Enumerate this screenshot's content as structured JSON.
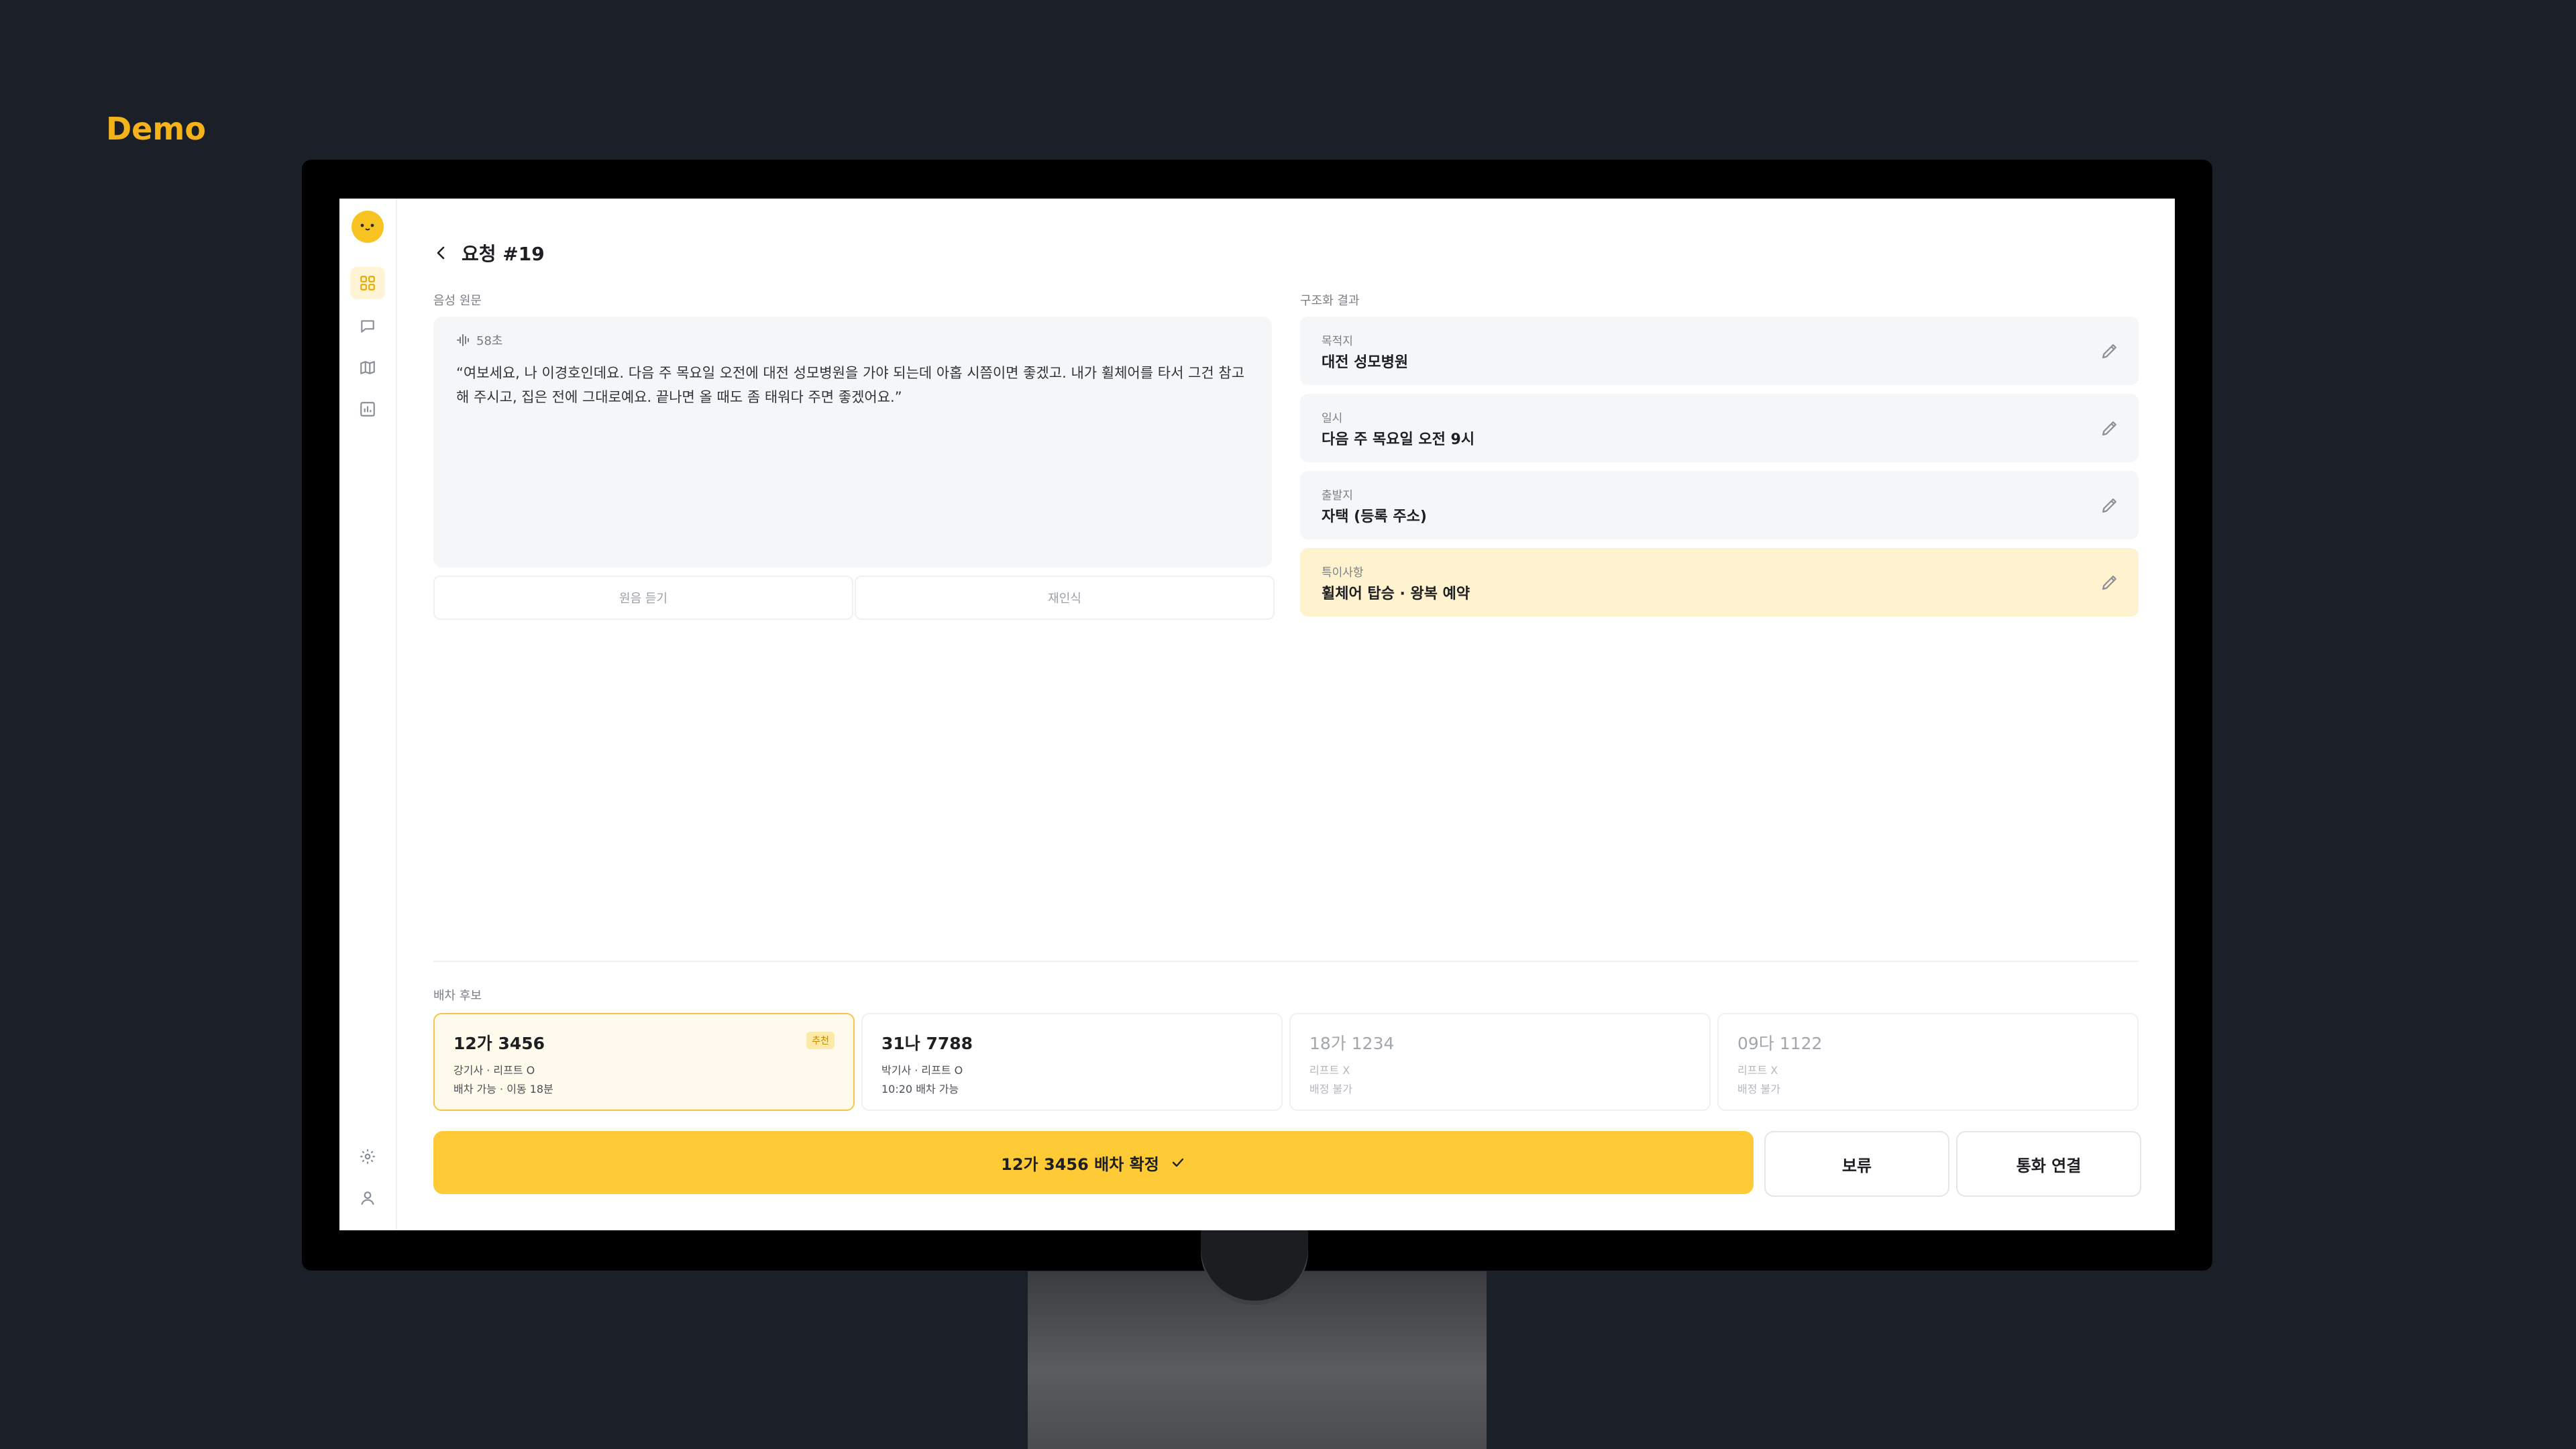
{
  "demo_label": "Demo",
  "brand": {
    "accent": "#fecb36",
    "highlight": "#fff2ce",
    "background": "#1b2028"
  },
  "sidebar": {
    "logo": "mascot-logo",
    "items": [
      {
        "icon": "dashboard-icon",
        "active": true
      },
      {
        "icon": "chat-icon",
        "active": false
      },
      {
        "icon": "map-icon",
        "active": false
      },
      {
        "icon": "chart-icon",
        "active": false
      }
    ],
    "bottom": [
      {
        "icon": "gear-icon"
      },
      {
        "icon": "user-icon"
      }
    ]
  },
  "header": {
    "title": "요청 #19"
  },
  "transcript": {
    "section_label": "음성 원문",
    "duration": "58초",
    "text": "“여보세요, 나 이경호인데요. 다음 주 목요일 오전에 대전 성모병원을 가야 되는데 아홉 시쯤이면 좋겠고. 내가 휠체어를 타서 그건 참고해 주시고, 집은 전에 그대로예요. 끝나면 올 때도 좀 태워다 주면 좋겠어요.”",
    "play_label": "원음 듣기",
    "retry_label": "재인식"
  },
  "structured": {
    "section_label": "구조화 결과",
    "fields": [
      {
        "label": "목적지",
        "value": "대전 성모병원",
        "highlight": false
      },
      {
        "label": "일시",
        "value": "다음 주 목요일 오전 9시",
        "highlight": false
      },
      {
        "label": "출발지",
        "value": "자택 (등록 주소)",
        "highlight": false
      },
      {
        "label": "특이사항",
        "value": "휠체어 탑승 · 왕복 예약",
        "highlight": true
      }
    ]
  },
  "candidates": {
    "section_label": "배차 후보",
    "items": [
      {
        "plate": "12가 3456",
        "line1": "강기사 · 리프트 O",
        "line2": "배차 가능 · 이동 18분",
        "badge": "추천",
        "selected": true,
        "dim": false
      },
      {
        "plate": "31나 7788",
        "line1": "박기사 · 리프트 O",
        "line2": "10:20 배차 가능",
        "badge": "",
        "selected": false,
        "dim": false
      },
      {
        "plate": "18가 1234",
        "line1": "리프트 X",
        "line2": "배정 불가",
        "badge": "",
        "selected": false,
        "dim": true
      },
      {
        "plate": "09다 1122",
        "line1": "리프트 X",
        "line2": "배정 불가",
        "badge": "",
        "selected": false,
        "dim": true
      }
    ]
  },
  "actions": {
    "confirm_label": "12가 3456 배차 확정",
    "hold_label": "보류",
    "call_label": "통화 연결"
  }
}
